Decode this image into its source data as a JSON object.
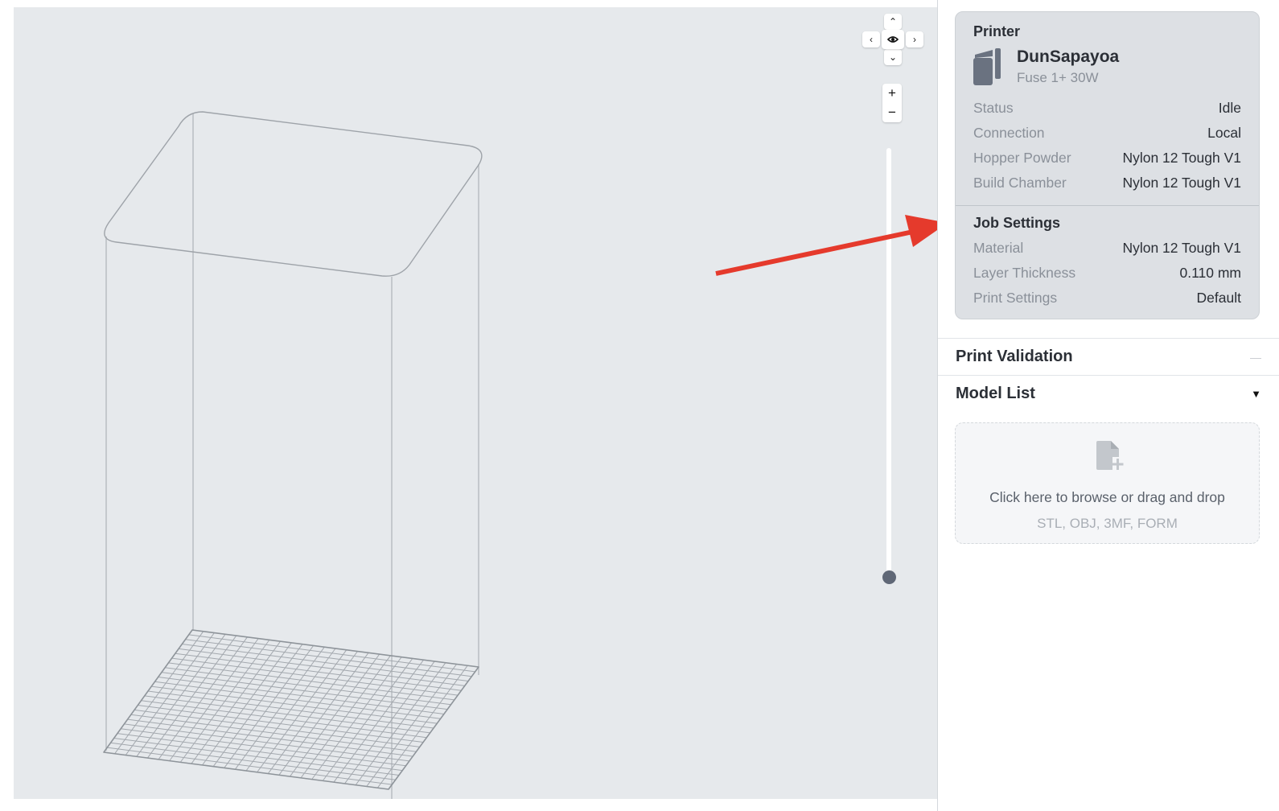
{
  "printer": {
    "heading": "Printer",
    "name": "DunSapayoa",
    "model": "Fuse 1+ 30W",
    "details": [
      {
        "label": "Status",
        "value": "Idle"
      },
      {
        "label": "Connection",
        "value": "Local"
      },
      {
        "label": "Hopper Powder",
        "value": "Nylon 12 Tough V1"
      },
      {
        "label": "Build Chamber",
        "value": "Nylon 12 Tough V1"
      }
    ]
  },
  "job_settings": {
    "heading": "Job Settings",
    "details": [
      {
        "label": "Material",
        "value": "Nylon 12 Tough V1"
      },
      {
        "label": "Layer Thickness",
        "value": "0.110 mm"
      },
      {
        "label": "Print Settings",
        "value": "Default"
      }
    ]
  },
  "print_validation": {
    "title": "Print Validation",
    "icon": "minus-icon"
  },
  "model_list": {
    "title": "Model List",
    "icon": "caret-down-icon",
    "dropzone_text": "Click here to browse or drag and drop",
    "dropzone_formats": "STL, OBJ, 3MF, FORM"
  },
  "view_controls": {
    "zoom_in": "+",
    "zoom_out": "−"
  },
  "layer_slider": {
    "position": 0.0
  },
  "colors": {
    "viewport_bg": "#e6e9ec",
    "annotation_arrow": "#e53a2c",
    "card_bg": "#dde0e4",
    "slider_thumb": "#5f6776"
  }
}
